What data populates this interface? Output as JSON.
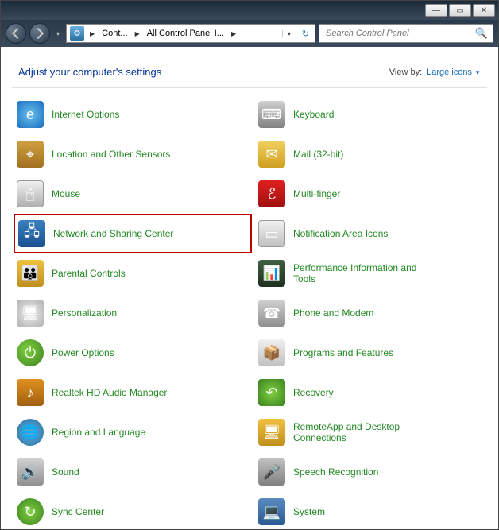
{
  "breadcrumb": {
    "seg1": "Cont...",
    "seg2": "All Control Panel I..."
  },
  "search": {
    "placeholder": "Search Control Panel"
  },
  "header": {
    "title": "Adjust your computer's settings",
    "viewby_label": "View by:",
    "viewby_value": "Large icons"
  },
  "items_left": [
    {
      "label": "Internet Options",
      "ic": "ic-ie",
      "name": "item-internet-options",
      "glyph": "e"
    },
    {
      "label": "Location and Other Sensors",
      "ic": "ic-loc",
      "name": "item-location",
      "glyph": "⌖"
    },
    {
      "label": "Mouse",
      "ic": "ic-mouse",
      "name": "item-mouse",
      "glyph": "🖱"
    },
    {
      "label": "Network and Sharing Center",
      "ic": "ic-net",
      "name": "item-network",
      "glyph": "🖧",
      "highlight": true
    },
    {
      "label": "Parental Controls",
      "ic": "ic-par",
      "name": "item-parental",
      "glyph": "👪"
    },
    {
      "label": "Personalization",
      "ic": "ic-pers",
      "name": "item-personalization",
      "glyph": "🖥"
    },
    {
      "label": "Power Options",
      "ic": "ic-power",
      "name": "item-power",
      "glyph": "⏻"
    },
    {
      "label": "Realtek HD Audio Manager",
      "ic": "ic-audio",
      "name": "item-realtek",
      "glyph": "♪"
    },
    {
      "label": "Region and Language",
      "ic": "ic-region",
      "name": "item-region",
      "glyph": "🌐"
    },
    {
      "label": "Sound",
      "ic": "ic-sound",
      "name": "item-sound",
      "glyph": "🔊"
    },
    {
      "label": "Sync Center",
      "ic": "ic-sync",
      "name": "item-sync",
      "glyph": "↻"
    }
  ],
  "items_right": [
    {
      "label": "Keyboard",
      "ic": "ic-kbd",
      "name": "item-keyboard",
      "glyph": "⌨"
    },
    {
      "label": "Mail (32-bit)",
      "ic": "ic-mail",
      "name": "item-mail",
      "glyph": "✉"
    },
    {
      "label": "Multi-finger",
      "ic": "ic-multi",
      "name": "item-multifinger",
      "glyph": "ℰ"
    },
    {
      "label": "Notification Area Icons",
      "ic": "ic-notif",
      "name": "item-notification",
      "glyph": "▭"
    },
    {
      "label": "Performance Information and Tools",
      "ic": "ic-perf",
      "name": "item-performance",
      "glyph": "📊"
    },
    {
      "label": "Phone and Modem",
      "ic": "ic-phone",
      "name": "item-phone",
      "glyph": "☎"
    },
    {
      "label": "Programs and Features",
      "ic": "ic-prog",
      "name": "item-programs",
      "glyph": "📦"
    },
    {
      "label": "Recovery",
      "ic": "ic-rec",
      "name": "item-recovery",
      "glyph": "↶"
    },
    {
      "label": "RemoteApp and Desktop Connections",
      "ic": "ic-remote",
      "name": "item-remoteapp",
      "glyph": "🖥"
    },
    {
      "label": "Speech Recognition",
      "ic": "ic-speech",
      "name": "item-speech",
      "glyph": "🎤"
    },
    {
      "label": "System",
      "ic": "ic-sys",
      "name": "item-system",
      "glyph": "💻"
    }
  ]
}
